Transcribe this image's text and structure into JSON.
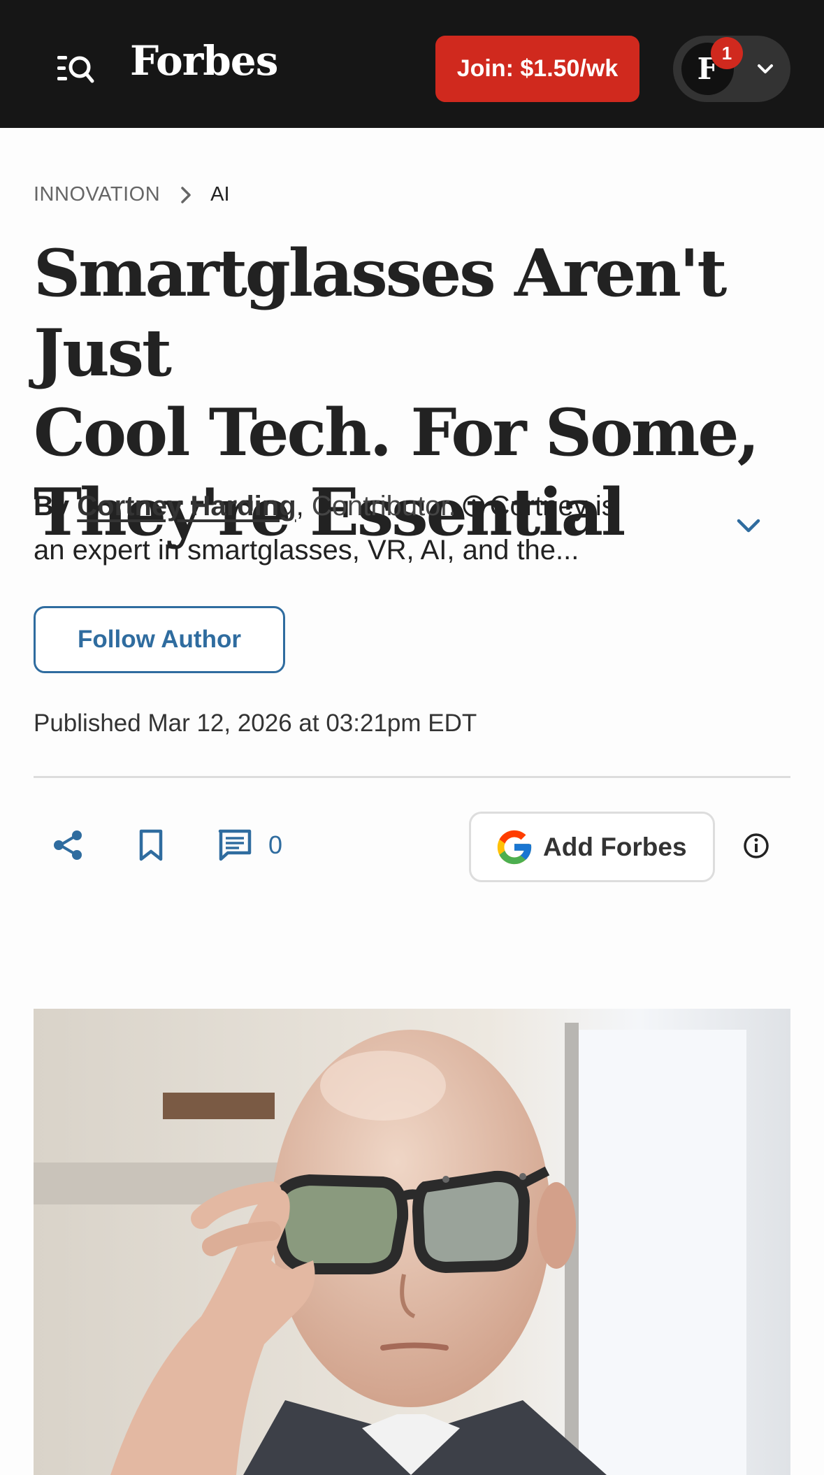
{
  "header": {
    "brand": "Forbes",
    "join_label": "Join: $1.50/wk",
    "avatar_letter": "F",
    "notification_count": "1",
    "colors": {
      "bar": "#161616",
      "join": "#d0291e"
    }
  },
  "breadcrumb": {
    "section": "INNOVATION",
    "subsection": "AI"
  },
  "article": {
    "headline_line1": "Smartglasses Aren't Just",
    "headline_line2": "Cool Tech. For Some,",
    "headline_line3": "They're Essential",
    "by_word": "By",
    "author": "Cortney Harding",
    "author_suffix": ",",
    "role": "Contributor.",
    "bio_preview_line1": "Cortney is",
    "bio_preview_line2": "an expert in smartglasses, VR, AI, and the...",
    "follow_label": "Follow Author",
    "published": "Published Mar 12, 2026 at 03:21pm EDT"
  },
  "actions": {
    "comment_count": "0",
    "add_label": "Add Forbes",
    "icons": [
      "share-icon",
      "bookmark-icon",
      "comment-icon",
      "google-g-icon",
      "info-icon"
    ],
    "accent": "#2f6c9f"
  },
  "hero": {
    "alt_icon": "portrait-photo"
  }
}
